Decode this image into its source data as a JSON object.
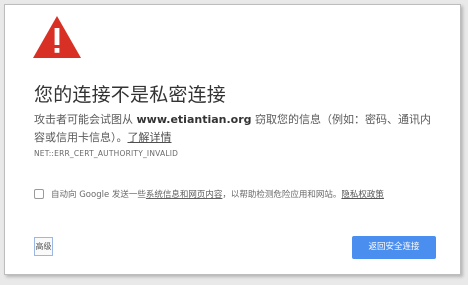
{
  "page": {
    "title": "您的连接不是私密连接",
    "description": {
      "prefix": "攻击者可能会试图从 ",
      "domain": "www.etiantian.org",
      "suffix": " 窃取您的信息（例如：密码、通讯内容或信用卡信息）。",
      "learn_more": "了解详情"
    },
    "error_code": "NET::ERR_CERT_AUTHORITY_INVALID",
    "checkbox": {
      "checked": false,
      "text_prefix": "自动向 Google 发送一些",
      "link_text": "系统信息和网页内容",
      "text_suffix": "，以帮助检测危险应用和网站。",
      "privacy_link": "隐私权政策"
    },
    "buttons": {
      "advanced": "高级",
      "back_to_safety": "返回安全连接"
    }
  },
  "icons": {
    "warning": "warning-triangle-icon"
  },
  "colors": {
    "warning_red": "#d93025",
    "primary_blue": "#4a8ef0",
    "title_text": "#333333"
  }
}
